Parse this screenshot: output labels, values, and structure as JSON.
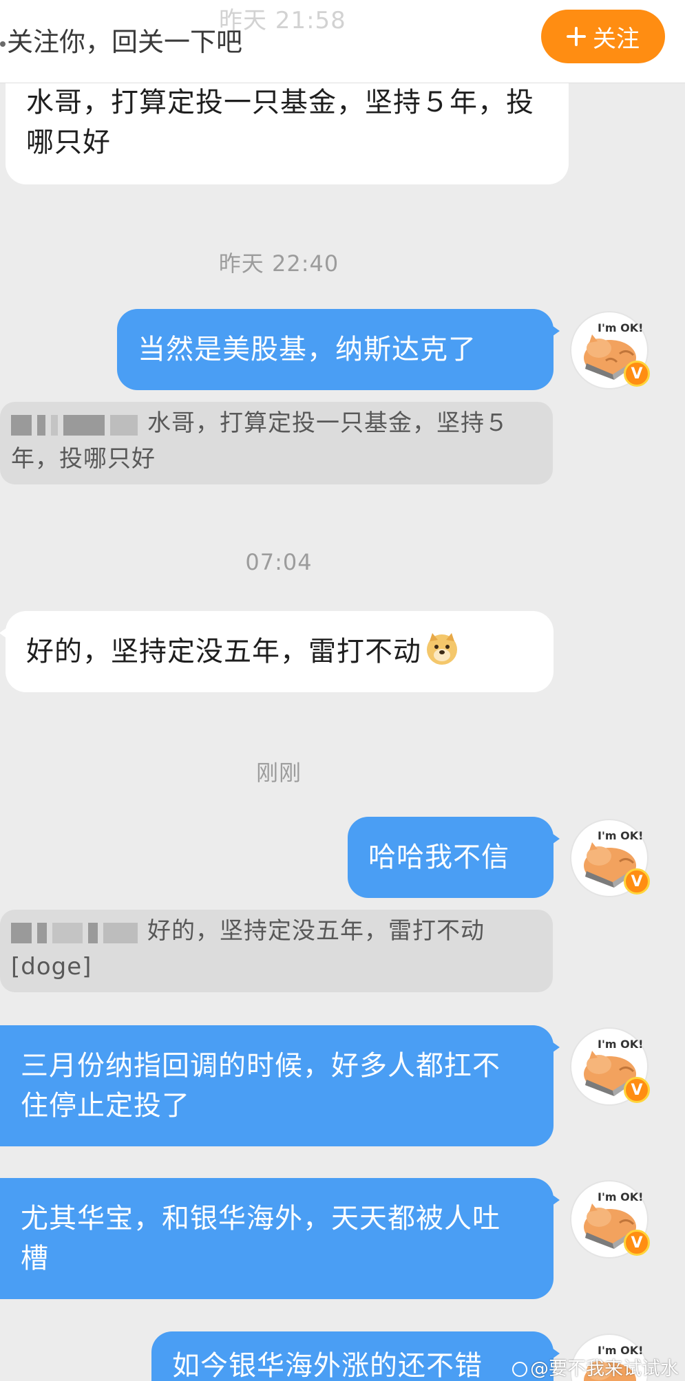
{
  "header": {
    "status_time": "昨天 21:58",
    "greeting": "关注你，回关一下吧",
    "follow_button": "关注"
  },
  "messages": {
    "m1": {
      "text": "水哥，打算定投一只基金，坚持５年，投哪只好"
    },
    "t1": {
      "text": "昨天 22:40"
    },
    "m2": {
      "text": "当然是美股基，纳斯达克了"
    },
    "q1": {
      "text": "水哥，打算定投一只基金，坚持５年，投哪只好"
    },
    "t2": {
      "text": "07:04"
    },
    "m3": {
      "text": "好的，坚持定没五年，雷打不动",
      "emoji": "doge-emoji"
    },
    "t3": {
      "text": "刚刚"
    },
    "m4": {
      "text": "哈哈我不信"
    },
    "q2": {
      "text": "好的，坚持定没五年，雷打不动[doge]"
    },
    "m5": {
      "text": "三月份纳指回调的时候，好多人都扛不住停止定投了"
    },
    "m6": {
      "text": "尤其华宝，和银华海外，天天都被人吐槽"
    },
    "m7": {
      "text": "如今银华海外涨的还不错"
    }
  },
  "avatar": {
    "caption": "I'm OK!",
    "badge": "V"
  },
  "watermark": {
    "text": "@要不我来试试水"
  },
  "colors": {
    "outgoing_bubble": "#4a9ef4",
    "incoming_bubble": "#ffffff",
    "follow_button": "#ff8d12",
    "chat_background": "#ececec",
    "quote_background": "#dcdcdc"
  }
}
